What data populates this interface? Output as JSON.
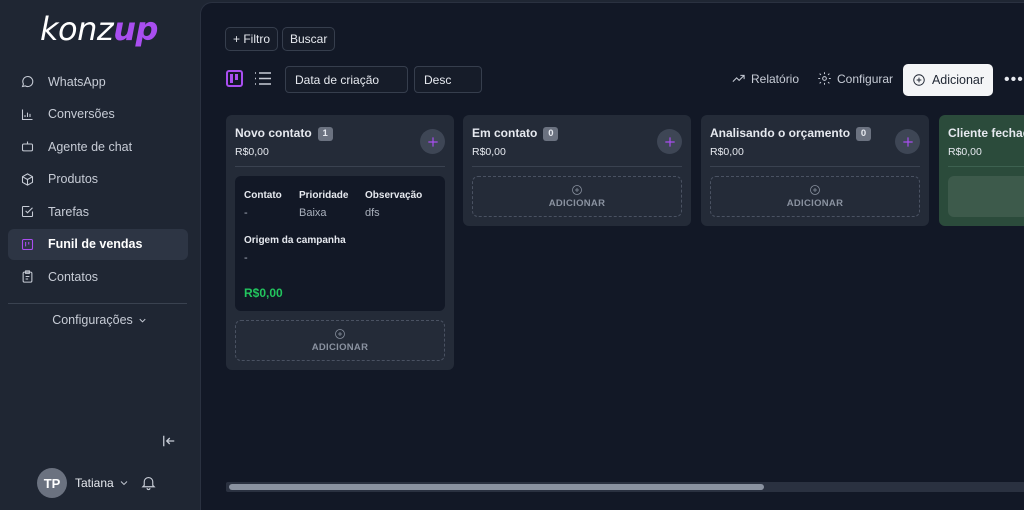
{
  "brand": {
    "part1": "konz",
    "part2": "up"
  },
  "sidebar": {
    "items": [
      {
        "label": "WhatsApp",
        "icon": "chat-bubble-icon",
        "active": false
      },
      {
        "label": "Conversões",
        "icon": "bar-chart-icon",
        "active": false
      },
      {
        "label": "Agente de chat",
        "icon": "robot-icon",
        "active": false
      },
      {
        "label": "Produtos",
        "icon": "box-icon",
        "active": false
      },
      {
        "label": "Tarefas",
        "icon": "checkbox-icon",
        "active": false
      },
      {
        "label": "Funil de vendas",
        "icon": "kanban-icon",
        "active": true
      },
      {
        "label": "Contatos",
        "icon": "clipboard-icon",
        "active": false
      }
    ],
    "settings_label": "Configurações"
  },
  "user": {
    "initials": "TP",
    "name": "Tatiana"
  },
  "toolbar": {
    "filter_label": "+ Filtro",
    "search_label": "Buscar",
    "sort_field": "Data de criação",
    "sort_order": "Desc",
    "report_label": "Relatório",
    "configure_label": "Configurar",
    "add_label": "Adicionar"
  },
  "board": {
    "add_zone_label": "ADICIONAR",
    "columns": [
      {
        "title": "Novo contato",
        "count": "1",
        "total": "R$0,00",
        "card": {
          "contact_key": "Contato",
          "contact_val": "-",
          "priority_key": "Prioridade",
          "priority_val": "Baixa",
          "note_key": "Observação",
          "note_val": "dfs",
          "campaign_key": "Origem da campanha",
          "campaign_val": "-",
          "value": "R$0,00"
        }
      },
      {
        "title": "Em contato",
        "count": "0",
        "total": "R$0,00"
      },
      {
        "title": "Analisando o orçamento",
        "count": "0",
        "total": "R$0,00"
      },
      {
        "title": "Cliente fechado",
        "count": "",
        "total": "R$0,00"
      }
    ]
  },
  "colors": {
    "accent": "#a94ef0",
    "success": "#22c55e",
    "won_column": "#2b4b3b"
  }
}
